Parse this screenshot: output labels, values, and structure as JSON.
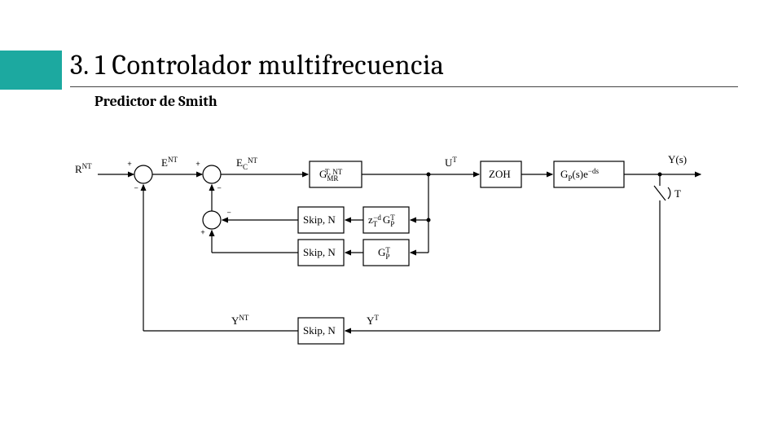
{
  "title": "3. 1 Controlador multifrecuencia",
  "subtitle": "Predictor de Smith",
  "signals": {
    "R": "R",
    "R_sup": "NT",
    "E": "E",
    "E_sup": "NT",
    "Ec": "E",
    "Ec_sub": "C",
    "Ec_sup": "NT",
    "U": "U",
    "U_sup": "T",
    "Y": "Y(s)",
    "YT": "Y",
    "YT_sup": "T",
    "YNT": "Y",
    "YNT_sup": "NT",
    "T": "T"
  },
  "blocks": {
    "Gmr_base": "G",
    "Gmr_sub": "MR",
    "Gmr_sup": "T, NT",
    "ZOH": "ZOH",
    "Gp_delay": "G",
    "Gp_delay_sub": "P",
    "Gp_delay_rest": "(s)e",
    "Gp_delay_exp": "−ds",
    "Skip": "Skip, N",
    "z_base": "z",
    "z_sub": "T",
    "z_sup": "−d",
    "GpT_base": "G",
    "GpT_sub": "P",
    "GpT_sup": "T"
  },
  "signs": {
    "plus": "+",
    "minus": "−"
  }
}
